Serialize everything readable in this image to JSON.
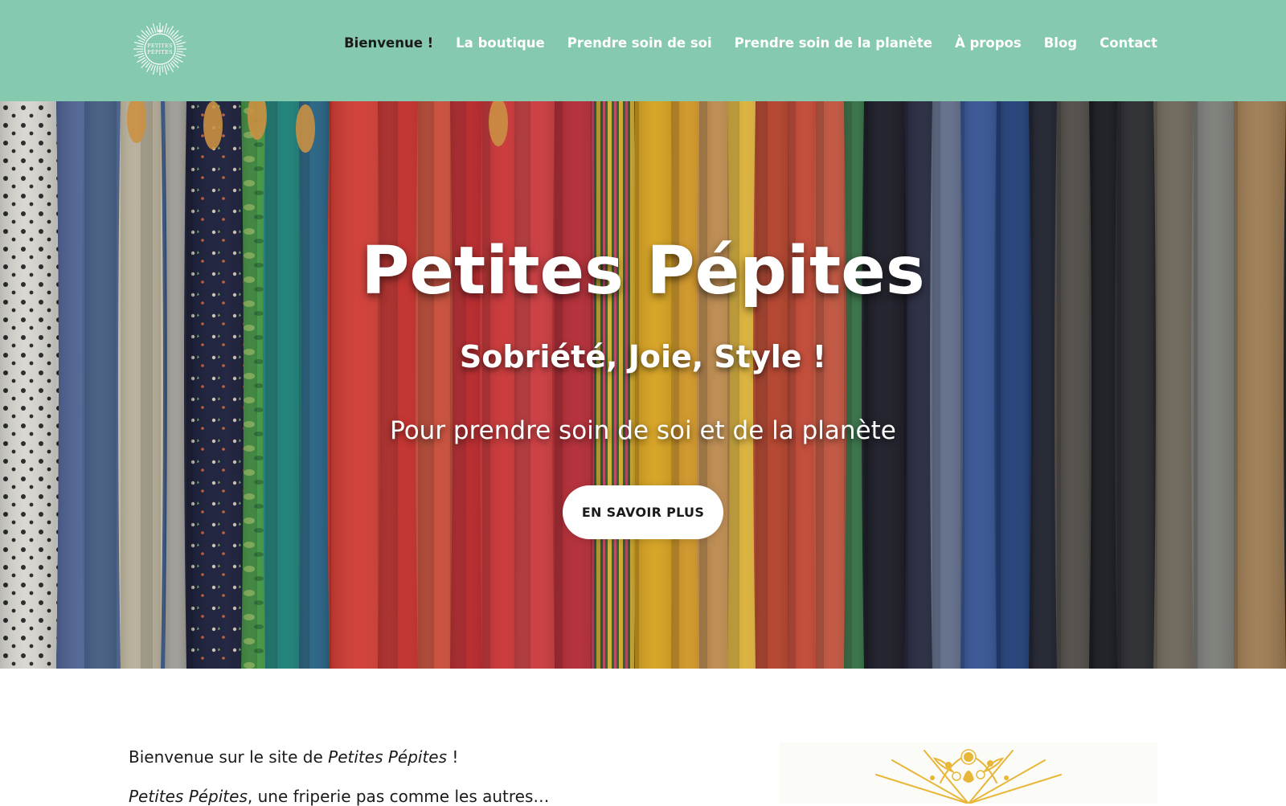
{
  "brand": {
    "logo_lines": [
      "Petites",
      "Pépites"
    ]
  },
  "nav": {
    "items": [
      {
        "label": "Bienvenue !",
        "active": true
      },
      {
        "label": "La boutique",
        "active": false
      },
      {
        "label": "Prendre soin de soi",
        "active": false
      },
      {
        "label": "Prendre soin de la planète",
        "active": false
      },
      {
        "label": "À propos",
        "active": false
      },
      {
        "label": "Blog",
        "active": false
      },
      {
        "label": "Contact",
        "active": false
      }
    ]
  },
  "hero": {
    "title": "Petites Pépites",
    "subtitle": "Sobriété, Joie, Style !",
    "description": "Pour prendre soin de soi et de la planète",
    "cta_label": "EN SAVOIR PLUS"
  },
  "content": {
    "welcome_prefix": "Bienvenue sur le site de ",
    "welcome_brand": "Petites Pépites",
    "welcome_suffix": " !",
    "tagline_brand": "Petites Pépites",
    "tagline_rest": ", une friperie pas comme les autres…"
  },
  "colors": {
    "header_bg": "#85c9ae",
    "nav_text": "#ffffff",
    "nav_active": "#1b1b1b",
    "illustration_gold": "#e8b73a"
  },
  "icons": {
    "logo": "petites-pepites-sun-logo",
    "illustration": "gold-floral-sunburst"
  }
}
